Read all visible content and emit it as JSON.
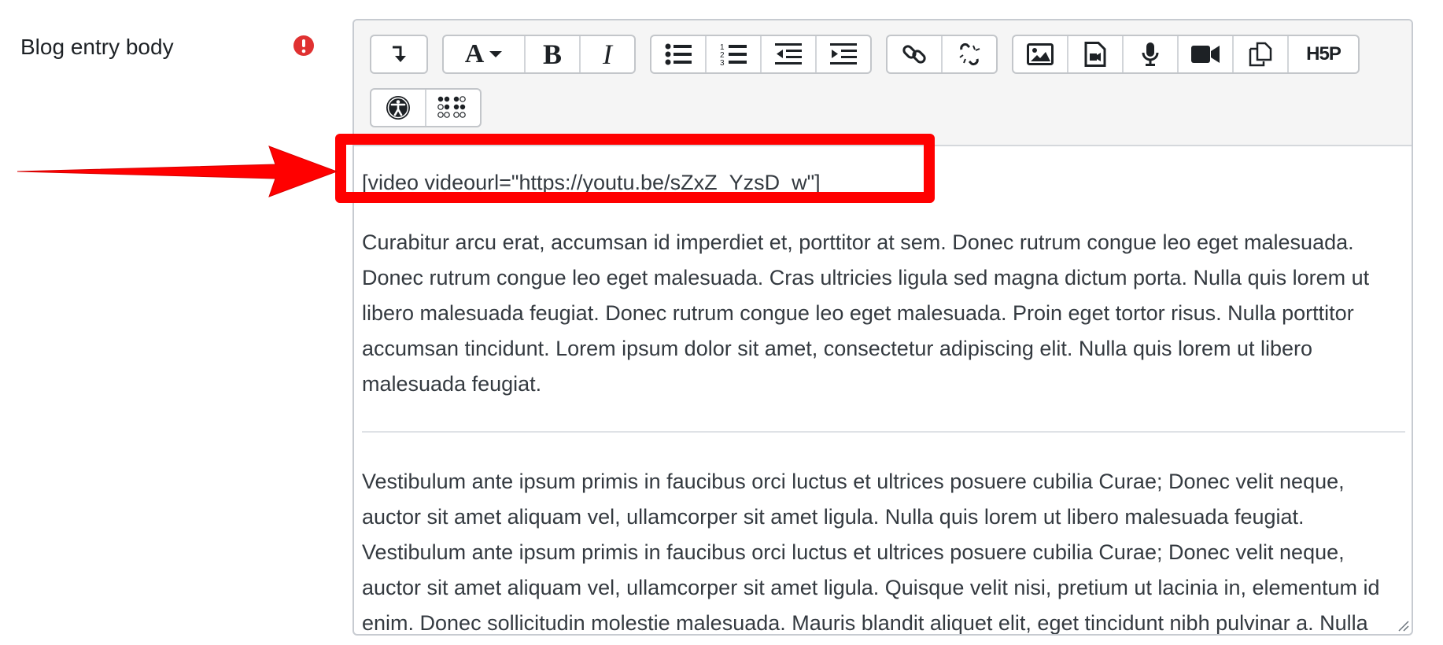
{
  "field": {
    "label": "Blog entry body",
    "required_icon": "exclamation-circle-icon",
    "required_color": "#e03131"
  },
  "toolbar": {
    "row1": [
      [
        "collapse-icon"
      ],
      [
        "font-icon",
        "bold-icon",
        "italic-icon"
      ],
      [
        "unordered-list-icon",
        "ordered-list-icon",
        "outdent-icon",
        "indent-icon"
      ],
      [
        "link-icon",
        "unlink-icon"
      ],
      [
        "image-icon",
        "media-icon",
        "record-audio-icon",
        "record-video-icon",
        "manage-files-icon",
        "h5p-icon"
      ]
    ],
    "row2": [
      [
        "accessibility-checker-icon",
        "screenreader-helper-icon"
      ]
    ],
    "bold_glyph": "B",
    "italic_glyph": "I",
    "font_glyph": "A",
    "h5p_label": "H5P"
  },
  "editor": {
    "shortcode": "[video videourl=\"https://youtu.be/sZxZ_YzsD_w\"]",
    "paragraph1": "Curabitur arcu erat, accumsan id imperdiet et, porttitor at sem. Donec rutrum congue leo eget malesuada. Donec rutrum congue leo eget malesuada. Cras ultricies ligula sed magna dictum porta. Nulla quis lorem ut libero malesuada feugiat. Donec rutrum congue leo eget malesuada. Proin eget tortor risus. Nulla porttitor accumsan tincidunt. Lorem ipsum dolor sit amet, consectetur adipiscing elit. Nulla quis lorem ut libero malesuada feugiat.",
    "paragraph2": "Vestibulum ante ipsum primis in faucibus orci luctus et ultrices posuere cubilia Curae; Donec velit neque, auctor sit amet aliquam vel, ullamcorper sit amet ligula. Nulla quis lorem ut libero malesuada feugiat. Vestibulum ante ipsum primis in faucibus orci luctus et ultrices posuere cubilia Curae; Donec velit neque, auctor sit amet aliquam vel, ullamcorper sit amet ligula. Quisque velit nisi, pretium ut lacinia in, elementum id enim. Donec sollicitudin molestie malesuada. Mauris blandit aliquet elit, eget tincidunt nibh pulvinar a. Nulla porttitor accumsan tincidunt. Pellentesque"
  },
  "annotation": {
    "color": "#ff0000",
    "arrow_icon": "red-arrow",
    "highlight": "red-highlight-box"
  }
}
